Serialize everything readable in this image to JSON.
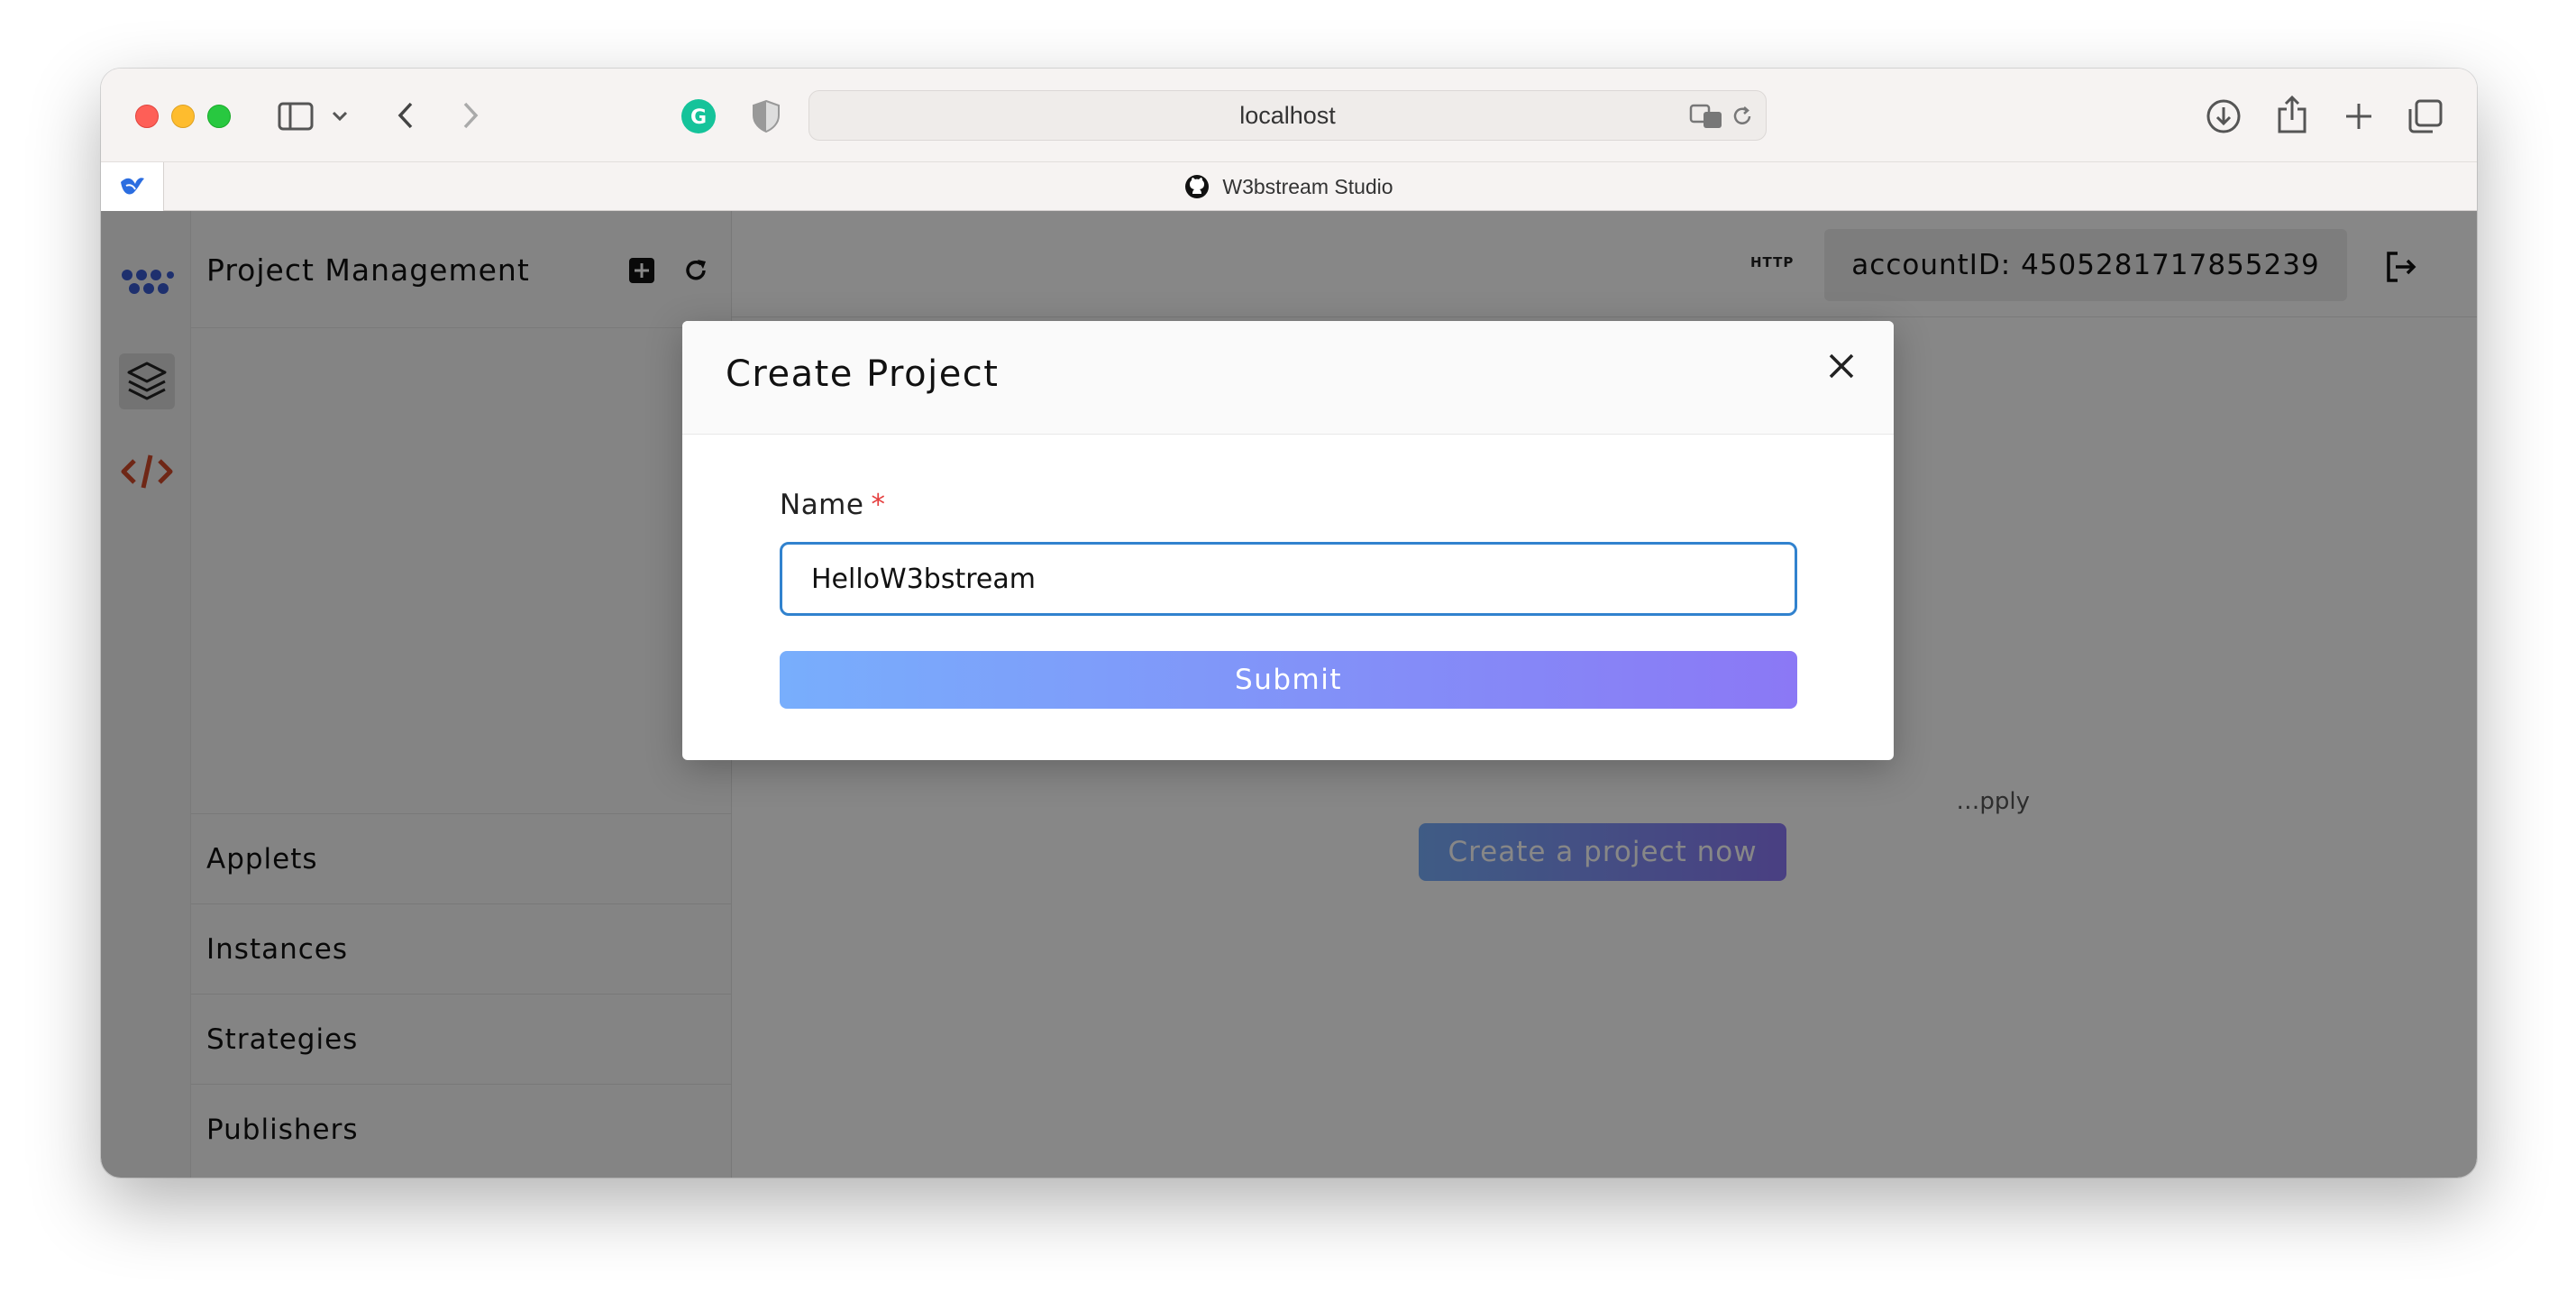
{
  "browser": {
    "url": "localhost",
    "tab_title": "W3bstream Studio"
  },
  "sidebar": {
    "title": "Project Management",
    "items": [
      {
        "label": "Applets"
      },
      {
        "label": "Instances"
      },
      {
        "label": "Strategies"
      },
      {
        "label": "Publishers"
      }
    ]
  },
  "header": {
    "protocol_tag": "HTTP",
    "account_label": "accountID: 4505281717855239"
  },
  "main": {
    "empty_hint": "…pply",
    "create_now_label": "Create a project now"
  },
  "modal": {
    "title": "Create Project",
    "field_label": "Name",
    "required_mark": "*",
    "name_value": "HelloW3bstream",
    "submit_label": "Submit"
  },
  "colors": {
    "accent_start": "#78aefc",
    "accent_end": "#8b78f5",
    "focus_border": "#3182ce",
    "required": "#e53e3e"
  }
}
